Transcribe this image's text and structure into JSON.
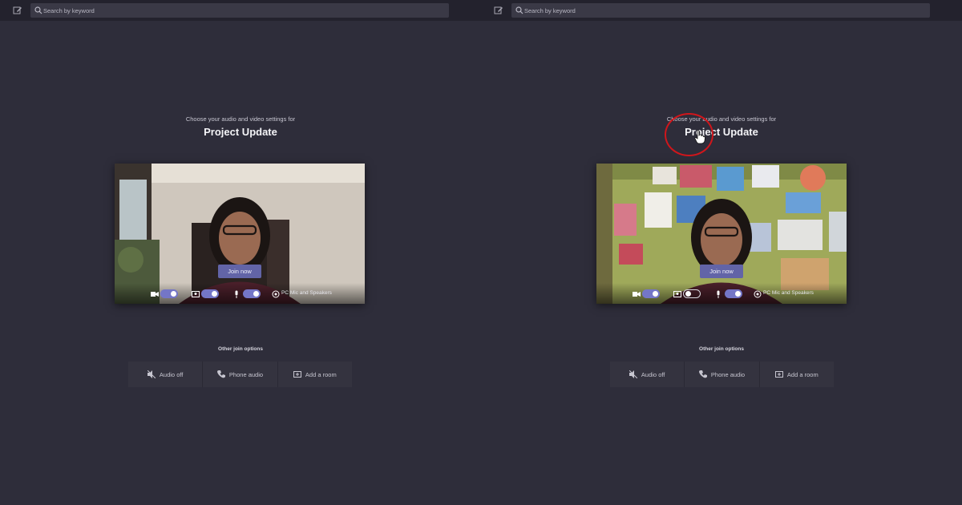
{
  "search": {
    "placeholder": "Search by keyword"
  },
  "prejoin": {
    "subtitle": "Choose your audio and video settings for",
    "meeting_title": "Project Update",
    "join_label": "Join now",
    "device_label": "PC Mic and Speakers"
  },
  "other_options": {
    "title": "Other join options",
    "items": [
      "Audio off",
      "Phone audio",
      "Add a room"
    ]
  },
  "toggles": {
    "left": {
      "camera": "on",
      "background_blur": "on",
      "microphone": "on"
    },
    "right": {
      "camera": "on",
      "background_blur": "off",
      "microphone": "on"
    }
  },
  "colors": {
    "accent": "#6264a7",
    "toggle_on": "#7476c7",
    "highlight": "#d0161b",
    "background": "#2e2d3a"
  }
}
